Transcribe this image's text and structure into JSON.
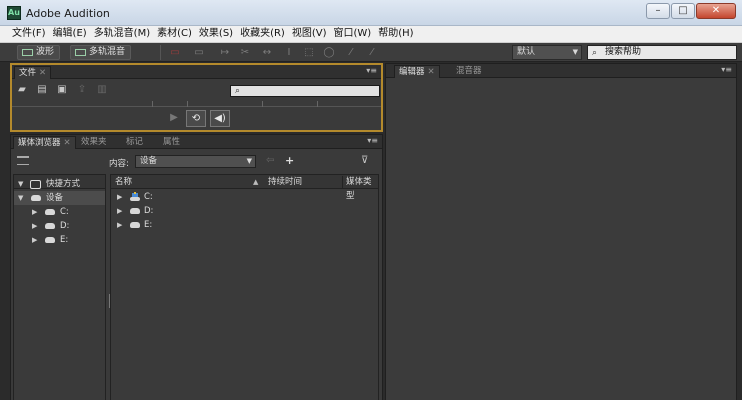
{
  "window": {
    "icon_text": "Au",
    "title": "Adobe Audition",
    "minimize": "–",
    "maximize": "□",
    "close": "✕"
  },
  "menu": [
    "文件(F)",
    "编辑(E)",
    "多轨混音(M)",
    "素材(C)",
    "效果(S)",
    "收藏夹(R)",
    "视图(V)",
    "窗口(W)",
    "帮助(H)"
  ],
  "toolbar": {
    "waveform_label": "波形",
    "multitrack_label": "多轨混音",
    "workspace_value": "默认",
    "help_search_placeholder": "搜索帮助"
  },
  "file_panel": {
    "tab_label": "文件",
    "search_placeholder": "",
    "menu_glyph": "▾≡"
  },
  "media_panel": {
    "tabs": [
      "媒体浏览器",
      "效果夹",
      "标记",
      "属性"
    ],
    "content_label": "内容:",
    "content_value": "设备",
    "tree": {
      "shortcuts_label": "快捷方式",
      "devices_label": "设备",
      "drives": [
        "C:",
        "D:",
        "E:"
      ]
    },
    "columns": {
      "name": "名称",
      "duration": "持续时间",
      "media_type": "媒体类型"
    },
    "items": [
      "C:",
      "D:",
      "E:"
    ]
  },
  "editor_panel": {
    "tabs": [
      "编辑器",
      "混音器"
    ]
  }
}
